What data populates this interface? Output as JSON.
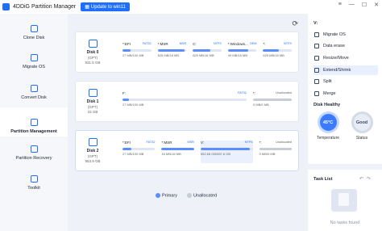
{
  "titlebar": {
    "app_title": "4DDiG Partition Manager",
    "update_label": "Update to win11"
  },
  "sidebar": {
    "items": [
      {
        "label": "Clone Disk",
        "icon": "clone-icon",
        "active": false
      },
      {
        "label": "Migrate OS",
        "icon": "migrate-icon",
        "active": false
      },
      {
        "label": "Convert Disk",
        "icon": "convert-icon",
        "active": false
      },
      {
        "label": "Partition Management",
        "icon": "partition-icon",
        "active": true
      },
      {
        "label": "Partition Recovery",
        "icon": "recovery-icon",
        "active": false
      },
      {
        "label": "Toolkit",
        "icon": "toolkit-icon",
        "active": false
      }
    ]
  },
  "disks": [
    {
      "name": "Disk 0",
      "type": "(GPT)",
      "size": "931.5 GB",
      "partitions": [
        {
          "label": "*:EFI",
          "fs": "FAT32",
          "size": "27 MB/100 MB",
          "fill": 0.27
        },
        {
          "label": "*:MSR",
          "fs": "MSR",
          "size": "625 MB/16 MB",
          "fill": 0.95
        },
        {
          "label": "C:",
          "fs": "NTFS",
          "size": "625 MB/16 MB",
          "fill": 0.6
        },
        {
          "label": "*:Windows...",
          "fs": "OEM",
          "size": "49 MB/16 MB",
          "fill": 0.7
        },
        {
          "label": "*:",
          "fs": "NTFS",
          "size": "625 MB/16 MB",
          "fill": 0.55
        }
      ]
    },
    {
      "name": "Disk 1",
      "type": "(GPT)",
      "size": "15 GB",
      "partitions": [
        {
          "label": "F:",
          "fs": "FAT32",
          "size": "27 MB/100 MB",
          "fill": 0.05
        },
        {
          "label": "*:",
          "fs": "Unallocated",
          "size": "0 MB/0 MB",
          "fill": 0.0
        }
      ]
    },
    {
      "name": "Disk 2",
      "type": "(GPT)",
      "size": "953.9 GB",
      "partitions": [
        {
          "label": "*:EFI",
          "fs": "FAT32",
          "size": "27 MB/100 MB",
          "fill": 0.27
        },
        {
          "label": "*:MSR",
          "fs": "MSR",
          "size": "16 MB/16 MB",
          "fill": 1.0
        },
        {
          "label": "V:",
          "fs": "NTFS",
          "size": "552.68 GB/557.6 GB",
          "fill": 0.95
        },
        {
          "label": "*:",
          "fs": "Unallocated",
          "size": "0 MB/0 MB",
          "fill": 0.0
        }
      ]
    }
  ],
  "legend": {
    "primary": "Primary",
    "unallocated": "Unallocated"
  },
  "colors": {
    "accent": "#1f6fff",
    "primary": "#5b8dff",
    "unallocated": "#c6cdd9"
  },
  "right_panel": {
    "drive_letter": "V:",
    "actions": [
      {
        "label": "Migrate OS",
        "selected": false
      },
      {
        "label": "Data erase",
        "selected": false
      },
      {
        "label": "Resize/Move",
        "selected": false
      },
      {
        "label": "Extend/Shrink",
        "selected": true
      },
      {
        "label": "Split",
        "selected": false
      },
      {
        "label": "Merge",
        "selected": false
      }
    ],
    "health_title": "Disk Healthy",
    "temperature_value": "45°C",
    "temperature_label": "Temperature",
    "status_value": "Good",
    "status_label": "Status",
    "task_title": "Task List",
    "no_tasks": "No tasks found"
  }
}
